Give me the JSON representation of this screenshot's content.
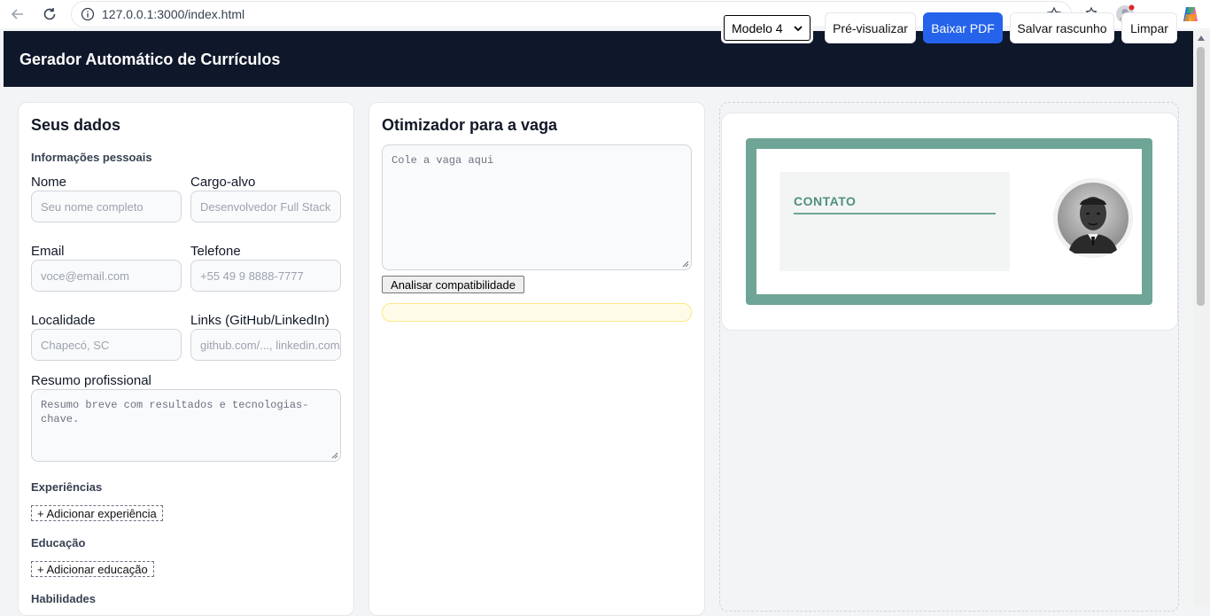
{
  "browser": {
    "url": "127.0.0.1:3000/index.html"
  },
  "header": {
    "title": "Gerador Automático de Currículos",
    "model_select": "Modelo 4",
    "preview_label": "Pré-visualizar",
    "download_label": "Baixar PDF",
    "save_draft_label": "Salvar rascunho",
    "clear_label": "Limpar"
  },
  "form": {
    "title": "Seus dados",
    "personal_section": "Informações pessoais",
    "name": {
      "label": "Nome",
      "placeholder": "Seu nome completo"
    },
    "role": {
      "label": "Cargo-alvo",
      "placeholder": "Desenvolvedor Full Stack"
    },
    "email": {
      "label": "Email",
      "placeholder": "voce@email.com"
    },
    "phone": {
      "label": "Telefone",
      "placeholder": "+55 49 9 8888-7777"
    },
    "location": {
      "label": "Localidade",
      "placeholder": "Chapecó, SC"
    },
    "links": {
      "label": "Links (GitHub/LinkedIn)",
      "placeholder": "github.com/..., linkedin.com/..."
    },
    "summary": {
      "label": "Resumo profissional",
      "placeholder": "Resumo breve com resultados e tecnologias-chave."
    },
    "experience_section": "Experiências",
    "add_experience": "+ Adicionar experiência",
    "education_section": "Educação",
    "add_education": "+ Adicionar educação",
    "skills_section": "Habilidades"
  },
  "optimizer": {
    "title": "Otimizador para a vaga",
    "job_placeholder": "Cole a vaga aqui",
    "analyze_label": "Analisar compatibilidade"
  },
  "preview": {
    "contact_title": "CONTATO"
  },
  "colors": {
    "header_bg": "#0f172a",
    "primary": "#2563eb",
    "resume_accent": "#6fa596"
  }
}
